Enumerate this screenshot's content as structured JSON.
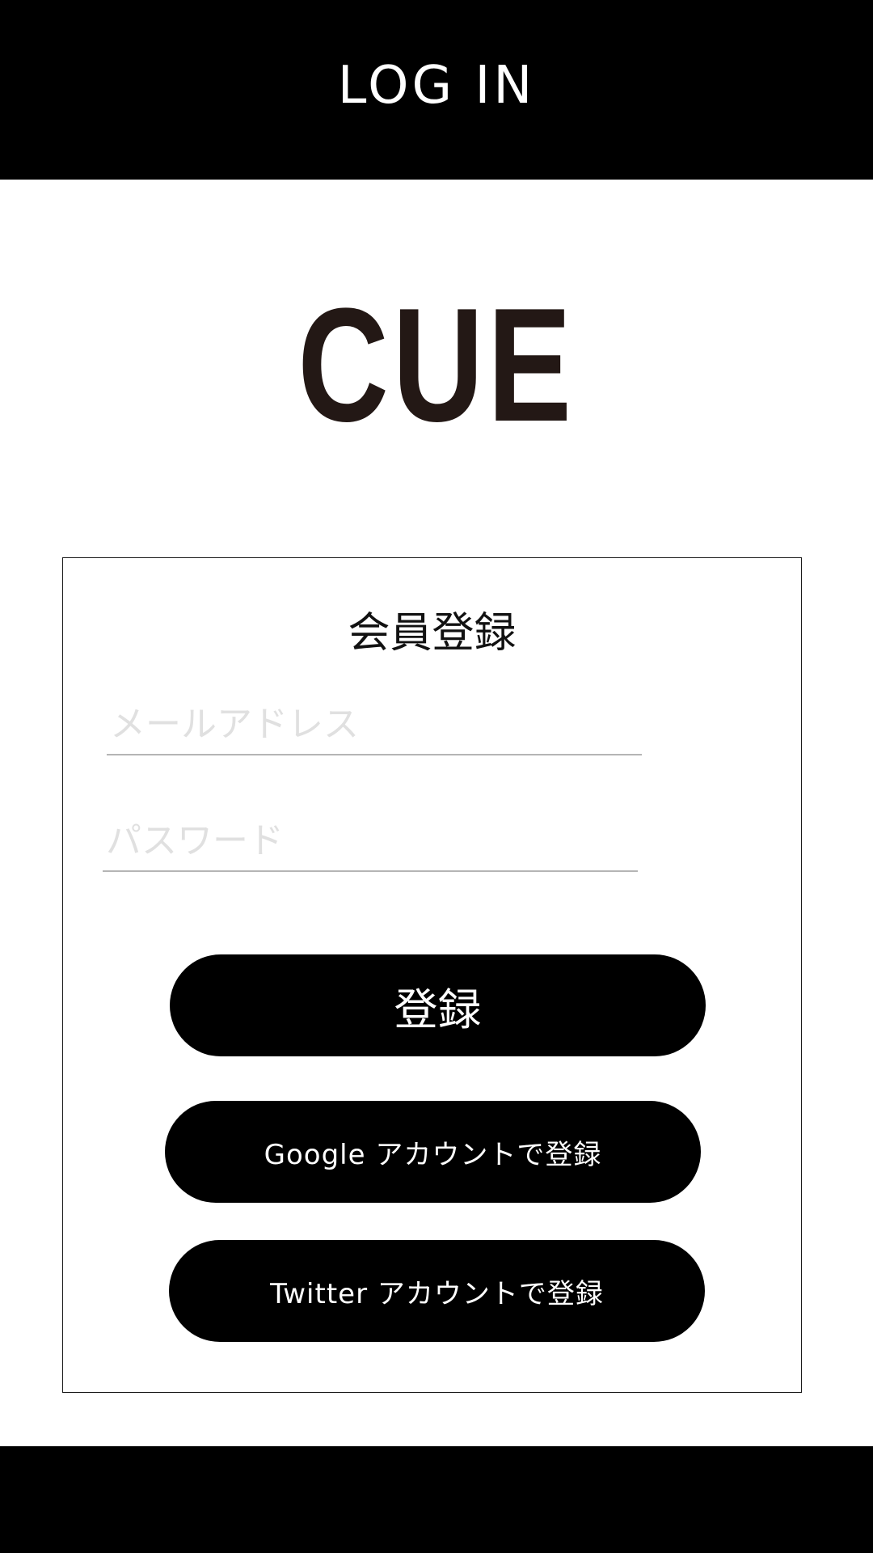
{
  "header": {
    "title": "LOG IN"
  },
  "logo": {
    "text": "CUE"
  },
  "form": {
    "title": "会員登録",
    "email": {
      "value": "",
      "placeholder": "メールアドレス"
    },
    "password": {
      "value": "",
      "placeholder": "パスワード"
    },
    "register_label": "登録",
    "google_label": "Google アカウントで登録",
    "twitter_label": "Twitter アカウントで登録"
  },
  "colors": {
    "bar": "#000000",
    "logo": "#231815",
    "placeholder": "#e0e0e0",
    "underline": "#b5b5b5"
  }
}
